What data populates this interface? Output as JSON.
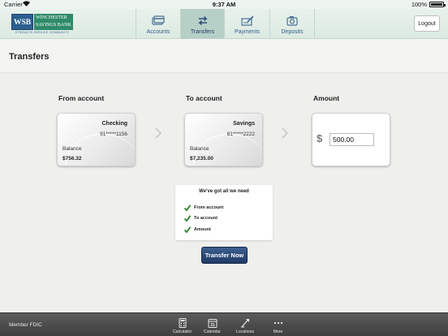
{
  "status_bar": {
    "carrier": "Carrier",
    "time": "9:37 AM",
    "battery": "100%"
  },
  "header": {
    "logo": {
      "mark": "WSB",
      "name_line1": "WINCHESTER",
      "name_line2": "SAVINGS BANK",
      "tagline": "STRENGTH SERVICE COMMUNITY"
    },
    "nav": [
      {
        "label": "Accounts",
        "icon": "accounts-icon"
      },
      {
        "label": "Transfers",
        "icon": "transfers-icon",
        "active": true
      },
      {
        "label": "Payments",
        "icon": "payments-icon"
      },
      {
        "label": "Deposits",
        "icon": "deposits-icon"
      }
    ],
    "logout_label": "Logout"
  },
  "page": {
    "title": "Transfers"
  },
  "transfer": {
    "from_label": "From account",
    "to_label": "To account",
    "amount_label": "Amount",
    "from_account": {
      "type": "Checking",
      "number": "91*****1156",
      "balance_label": "Balance",
      "balance": "$756.32"
    },
    "to_account": {
      "type": "Savings",
      "number": "81*****2222",
      "balance_label": "Balance",
      "balance": "$7,235.00"
    },
    "currency_symbol": "$",
    "amount_value": "500.00"
  },
  "checklist": {
    "title": "We've got all we need",
    "items": [
      "From account",
      "To account",
      "Amount"
    ]
  },
  "transfer_button_label": "Transfer Now",
  "footer": {
    "fdic": "Member FDIC",
    "tools": [
      {
        "label": "Calculator",
        "icon": "calculator-icon"
      },
      {
        "label": "Calendar",
        "icon": "calendar-icon",
        "day": "31"
      },
      {
        "label": "Locations",
        "icon": "locations-icon"
      },
      {
        "label": "More",
        "icon": "more-icon"
      }
    ]
  },
  "colors": {
    "header_bg": "#e8f2ec",
    "active_tab": "#b7d0c7",
    "nav_text": "#355e8a",
    "button": "#2a4a7a",
    "check": "#2c7f2c",
    "footer": "#4a4a4a"
  }
}
